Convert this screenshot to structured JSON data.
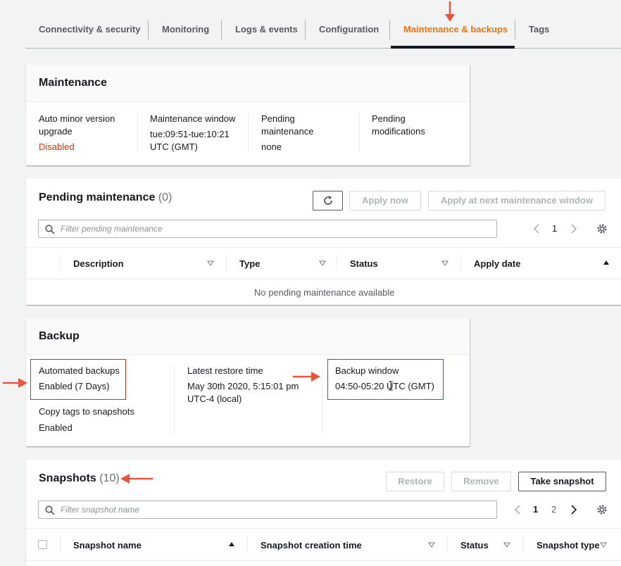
{
  "tabs": [
    "Connectivity & security",
    "Monitoring",
    "Logs & events",
    "Configuration",
    "Maintenance & backups",
    "Tags"
  ],
  "maintenance": {
    "title": "Maintenance",
    "auto_minor_label_1": "Auto minor version",
    "auto_minor_label_2": "upgrade",
    "auto_minor_value": "Disabled",
    "window_label": "Maintenance window",
    "window_value_1": "tue:09:51-tue:10:21",
    "window_value_2": "UTC (GMT)",
    "pending_label_1": "Pending",
    "pending_label_2": "maintenance",
    "pending_value": "none",
    "pending_mod_label_1": "Pending",
    "pending_mod_label_2": "modifications"
  },
  "pending": {
    "title": "Pending maintenance",
    "count": "(0)",
    "apply_now": "Apply now",
    "apply_next": "Apply at next maintenance window",
    "search_placeholder": "Filter pending maintenance",
    "page": "1",
    "columns": [
      "Description",
      "Type",
      "Status",
      "Apply date"
    ],
    "empty": "No pending maintenance available"
  },
  "backup": {
    "title": "Backup",
    "auto_label": "Automated backups",
    "auto_value": "Enabled (7 Days)",
    "copy_label": "Copy tags to snapshots",
    "copy_value": "Enabled",
    "restore_label": "Latest restore time",
    "restore_value_1": "May 30th 2020, 5:15:01 pm",
    "restore_value_2": "UTC-4 (local)",
    "window_label": "Backup window",
    "window_value": "04:50-05:20 UTC (GMT)"
  },
  "snapshots": {
    "title": "Snapshots",
    "count": "(10)",
    "restore": "Restore",
    "remove": "Remove",
    "take": "Take snapshot",
    "search_placeholder": "Filter snapshot name",
    "pages": [
      "1",
      "2"
    ],
    "columns": [
      "Snapshot name",
      "Snapshot creation time",
      "Status",
      "Snapshot type"
    ]
  },
  "colors": {
    "accent": "#ec7211",
    "annotation": "#e8553e",
    "disabled": "#d13212"
  }
}
